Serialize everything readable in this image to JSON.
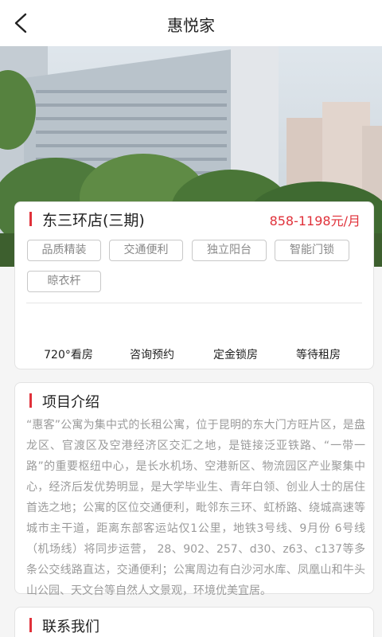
{
  "header": {
    "title": "惠悦家",
    "back_icon": "chevron-left-icon"
  },
  "hero": {
    "image": "apartment-building-photo"
  },
  "store": {
    "name": "东三环店(三期)",
    "price": "858-1198元/月",
    "accent_color": "#e0313a",
    "tags": [
      "品质精装",
      "交通便利",
      "独立阳台",
      "智能门锁",
      "晾衣杆"
    ],
    "actions": [
      "720°看房",
      "咨询预约",
      "定金锁房",
      "等待租房"
    ]
  },
  "intro": {
    "title": "项目介绍",
    "body": "“惠客”公寓为集中式的长租公寓，位于昆明的东大门方旺片区，是盘龙区、官渡区及空港经济区交汇之地，是链接泛亚铁路、“一带一路”的重要枢纽中心，是长水机场、空港新区、物流园区产业聚集中心，经济后发优势明显，是大学毕业生、青年白领、创业人士的居住首选之地；公寓的区位交通便利，毗邻东三环、虹桥路、绕城高速等城市主干道，距离东部客运站仅1公里，地铁3号线、9月份 6号线（机场线）将同步运营， 28、902、257、d30、z63、c137等多条公交线路直达，交通便利；公寓周边有白沙河水库、凤凰山和牛头山公园、天文台等自然人文景观，环境优美宜居。"
  },
  "contact": {
    "title": "联系我们"
  }
}
